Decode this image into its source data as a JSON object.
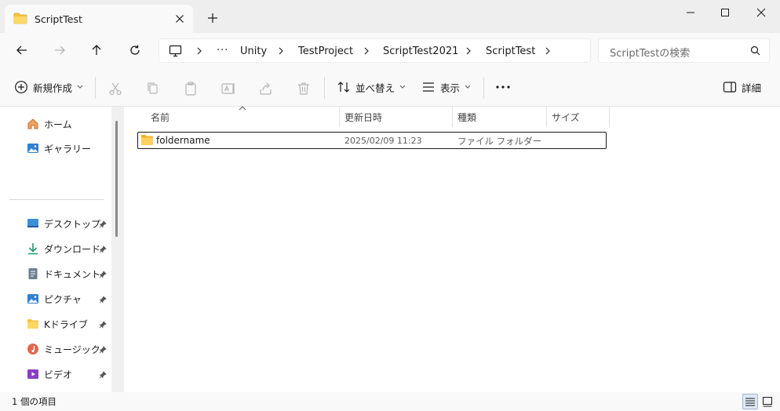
{
  "window": {
    "tab_title": "ScriptTest",
    "new_tab_label": "+",
    "minimize_label": "minimize",
    "maximize_label": "maximize",
    "close_label": "close"
  },
  "navigation": {
    "back": "back-arrow",
    "forward": "forward-arrow",
    "up": "up-arrow",
    "refresh": "refresh"
  },
  "breadcrumb": {
    "more": "···",
    "items": [
      "Unity",
      "TestProject",
      "ScriptTest2021",
      "ScriptTest"
    ]
  },
  "search": {
    "placeholder": "ScriptTestの検索"
  },
  "commandbar": {
    "new_label": "新規作成",
    "sort_label": "並べ替え",
    "view_label": "表示",
    "more_label": "···",
    "details_label": "詳細"
  },
  "sidebar": {
    "top_items": [
      {
        "label": "ホーム",
        "icon": "home-icon"
      },
      {
        "label": "ギャラリー",
        "icon": "gallery-icon"
      }
    ],
    "pinned_items": [
      {
        "label": "デスクトップ",
        "icon": "desktop-icon"
      },
      {
        "label": "ダウンロード",
        "icon": "download-icon"
      },
      {
        "label": "ドキュメント",
        "icon": "documents-icon"
      },
      {
        "label": "ピクチャ",
        "icon": "pictures-icon"
      },
      {
        "label": "Kドライブ",
        "icon": "folder-icon"
      },
      {
        "label": "ミュージック",
        "icon": "music-icon"
      },
      {
        "label": "ビデオ",
        "icon": "video-icon"
      }
    ]
  },
  "filelist": {
    "columns": [
      "名前",
      "更新日時",
      "種類",
      "サイズ"
    ],
    "rows": [
      {
        "name": "foldername",
        "modified": "2025/02/09 11:23",
        "type": "ファイル フォルダー",
        "size": ""
      }
    ]
  },
  "statusbar": {
    "count": "1 個の項目"
  },
  "colors": {
    "accent": "#0067c0",
    "folder": "#f4c542",
    "selection_border": "#1a1a1a"
  }
}
